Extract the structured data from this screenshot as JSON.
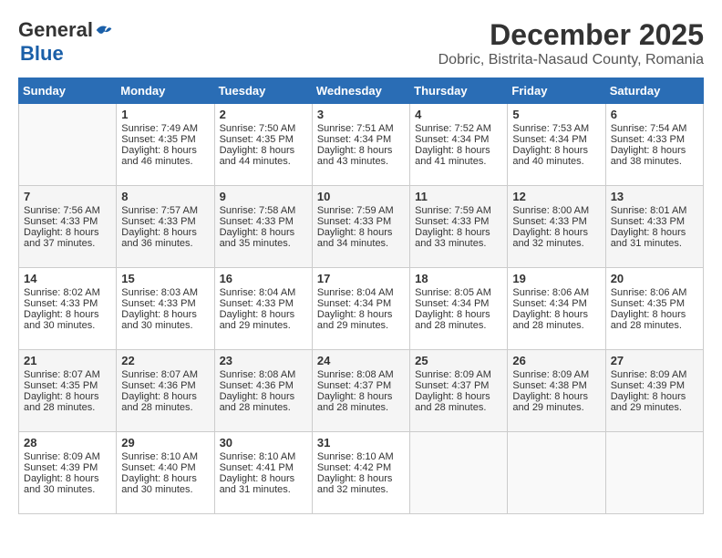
{
  "header": {
    "logo_general": "General",
    "logo_blue": "Blue",
    "title": "December 2025",
    "subtitle": "Dobric, Bistrita-Nasaud County, Romania"
  },
  "calendar": {
    "days_of_week": [
      "Sunday",
      "Monday",
      "Tuesday",
      "Wednesday",
      "Thursday",
      "Friday",
      "Saturday"
    ],
    "weeks": [
      [
        {
          "day": "",
          "info": ""
        },
        {
          "day": "1",
          "info": "Sunrise: 7:49 AM\nSunset: 4:35 PM\nDaylight: 8 hours\nand 46 minutes."
        },
        {
          "day": "2",
          "info": "Sunrise: 7:50 AM\nSunset: 4:35 PM\nDaylight: 8 hours\nand 44 minutes."
        },
        {
          "day": "3",
          "info": "Sunrise: 7:51 AM\nSunset: 4:34 PM\nDaylight: 8 hours\nand 43 minutes."
        },
        {
          "day": "4",
          "info": "Sunrise: 7:52 AM\nSunset: 4:34 PM\nDaylight: 8 hours\nand 41 minutes."
        },
        {
          "day": "5",
          "info": "Sunrise: 7:53 AM\nSunset: 4:34 PM\nDaylight: 8 hours\nand 40 minutes."
        },
        {
          "day": "6",
          "info": "Sunrise: 7:54 AM\nSunset: 4:33 PM\nDaylight: 8 hours\nand 38 minutes."
        }
      ],
      [
        {
          "day": "7",
          "info": "Sunrise: 7:56 AM\nSunset: 4:33 PM\nDaylight: 8 hours\nand 37 minutes."
        },
        {
          "day": "8",
          "info": "Sunrise: 7:57 AM\nSunset: 4:33 PM\nDaylight: 8 hours\nand 36 minutes."
        },
        {
          "day": "9",
          "info": "Sunrise: 7:58 AM\nSunset: 4:33 PM\nDaylight: 8 hours\nand 35 minutes."
        },
        {
          "day": "10",
          "info": "Sunrise: 7:59 AM\nSunset: 4:33 PM\nDaylight: 8 hours\nand 34 minutes."
        },
        {
          "day": "11",
          "info": "Sunrise: 7:59 AM\nSunset: 4:33 PM\nDaylight: 8 hours\nand 33 minutes."
        },
        {
          "day": "12",
          "info": "Sunrise: 8:00 AM\nSunset: 4:33 PM\nDaylight: 8 hours\nand 32 minutes."
        },
        {
          "day": "13",
          "info": "Sunrise: 8:01 AM\nSunset: 4:33 PM\nDaylight: 8 hours\nand 31 minutes."
        }
      ],
      [
        {
          "day": "14",
          "info": "Sunrise: 8:02 AM\nSunset: 4:33 PM\nDaylight: 8 hours\nand 30 minutes."
        },
        {
          "day": "15",
          "info": "Sunrise: 8:03 AM\nSunset: 4:33 PM\nDaylight: 8 hours\nand 30 minutes."
        },
        {
          "day": "16",
          "info": "Sunrise: 8:04 AM\nSunset: 4:33 PM\nDaylight: 8 hours\nand 29 minutes."
        },
        {
          "day": "17",
          "info": "Sunrise: 8:04 AM\nSunset: 4:34 PM\nDaylight: 8 hours\nand 29 minutes."
        },
        {
          "day": "18",
          "info": "Sunrise: 8:05 AM\nSunset: 4:34 PM\nDaylight: 8 hours\nand 28 minutes."
        },
        {
          "day": "19",
          "info": "Sunrise: 8:06 AM\nSunset: 4:34 PM\nDaylight: 8 hours\nand 28 minutes."
        },
        {
          "day": "20",
          "info": "Sunrise: 8:06 AM\nSunset: 4:35 PM\nDaylight: 8 hours\nand 28 minutes."
        }
      ],
      [
        {
          "day": "21",
          "info": "Sunrise: 8:07 AM\nSunset: 4:35 PM\nDaylight: 8 hours\nand 28 minutes."
        },
        {
          "day": "22",
          "info": "Sunrise: 8:07 AM\nSunset: 4:36 PM\nDaylight: 8 hours\nand 28 minutes."
        },
        {
          "day": "23",
          "info": "Sunrise: 8:08 AM\nSunset: 4:36 PM\nDaylight: 8 hours\nand 28 minutes."
        },
        {
          "day": "24",
          "info": "Sunrise: 8:08 AM\nSunset: 4:37 PM\nDaylight: 8 hours\nand 28 minutes."
        },
        {
          "day": "25",
          "info": "Sunrise: 8:09 AM\nSunset: 4:37 PM\nDaylight: 8 hours\nand 28 minutes."
        },
        {
          "day": "26",
          "info": "Sunrise: 8:09 AM\nSunset: 4:38 PM\nDaylight: 8 hours\nand 29 minutes."
        },
        {
          "day": "27",
          "info": "Sunrise: 8:09 AM\nSunset: 4:39 PM\nDaylight: 8 hours\nand 29 minutes."
        }
      ],
      [
        {
          "day": "28",
          "info": "Sunrise: 8:09 AM\nSunset: 4:39 PM\nDaylight: 8 hours\nand 30 minutes."
        },
        {
          "day": "29",
          "info": "Sunrise: 8:10 AM\nSunset: 4:40 PM\nDaylight: 8 hours\nand 30 minutes."
        },
        {
          "day": "30",
          "info": "Sunrise: 8:10 AM\nSunset: 4:41 PM\nDaylight: 8 hours\nand 31 minutes."
        },
        {
          "day": "31",
          "info": "Sunrise: 8:10 AM\nSunset: 4:42 PM\nDaylight: 8 hours\nand 32 minutes."
        },
        {
          "day": "",
          "info": ""
        },
        {
          "day": "",
          "info": ""
        },
        {
          "day": "",
          "info": ""
        }
      ]
    ]
  }
}
